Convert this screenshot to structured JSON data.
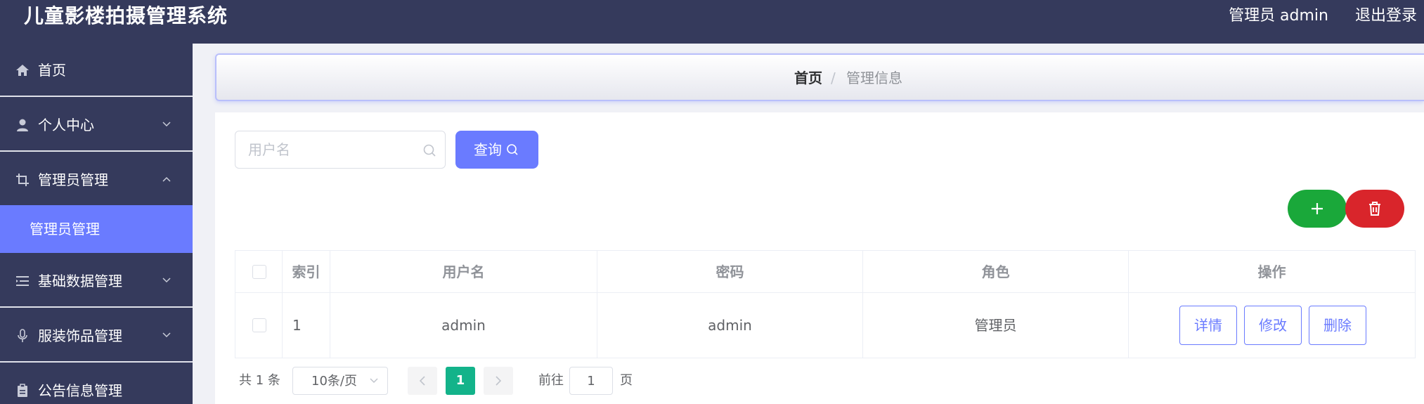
{
  "header": {
    "app_title": "儿童影楼拍摄管理系统",
    "user_info": "管理员 admin",
    "logout_label": "退出登录"
  },
  "sidebar": {
    "items": [
      {
        "label": "首页",
        "icon": "home-icon"
      },
      {
        "label": "个人中心",
        "icon": "user-icon"
      },
      {
        "label": "管理员管理",
        "icon": "crop-icon"
      },
      {
        "label": "基础数据管理",
        "icon": "list-icon"
      },
      {
        "label": "服装饰品管理",
        "icon": "microphone-icon"
      },
      {
        "label": "公告信息管理",
        "icon": "clipboard-icon"
      }
    ],
    "active_subitem": "管理员管理"
  },
  "breadcrumb": {
    "home": "首页",
    "separator": "/",
    "current": "管理信息"
  },
  "search": {
    "placeholder": "用户名",
    "value": "",
    "query_label": "查询"
  },
  "table": {
    "headers": [
      "索引",
      "用户名",
      "密码",
      "角色",
      "操作"
    ],
    "rows": [
      {
        "index": "1",
        "username": "admin",
        "password": "admin",
        "role": "管理员"
      }
    ],
    "actions": {
      "detail": "详情",
      "edit": "修改",
      "delete": "删除"
    }
  },
  "pagination": {
    "total": "共 1 条",
    "page_size": "10条/页",
    "current_page": "1",
    "goto_label": "前往",
    "goto_value": "1",
    "page_suffix": "页"
  },
  "colors": {
    "header_bg": "#353a5c",
    "accent": "#6a7bff",
    "add": "#1aa83a",
    "delete": "#d9252b",
    "pager_active": "#13b38a"
  }
}
